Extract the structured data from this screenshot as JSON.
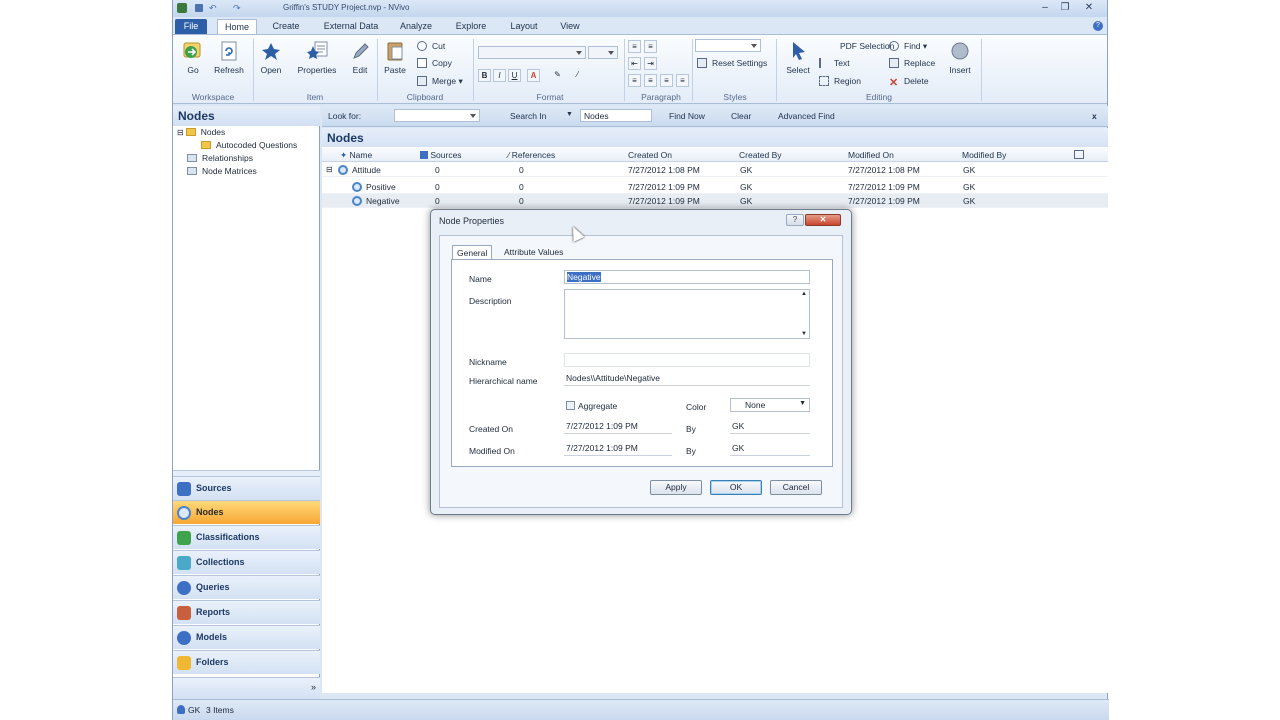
{
  "window": {
    "title": "Griffin's STUDY Project.nvp - NVivo",
    "controls": [
      "–",
      "❐",
      "✕"
    ]
  },
  "ribbon": {
    "file_tab": "File",
    "tabs": [
      "Home",
      "Create",
      "External Data",
      "Analyze",
      "Explore",
      "Layout",
      "View"
    ],
    "workspace": {
      "go": "Go",
      "refresh": "Refresh",
      "label": "Workspace"
    },
    "item": {
      "open": "Open",
      "properties": "Properties",
      "edit": "Edit",
      "label": "Item"
    },
    "clipboard": {
      "paste": "Paste",
      "cut": "Cut",
      "copy": "Copy",
      "merge": "Merge",
      "label": "Clipboard"
    },
    "format": {
      "label": "Format"
    },
    "paragraph": {
      "label": "Paragraph"
    },
    "styles": {
      "reset": "Reset Settings",
      "label": "Styles"
    },
    "editing": {
      "select": "Select",
      "pdf_selection": "PDF Selection",
      "text": "Text",
      "region": "Region",
      "find": "Find",
      "replace": "Replace",
      "delete": "Delete",
      "insert": "Insert",
      "label": "Editing"
    }
  },
  "nav": {
    "header": "Nodes",
    "tree": [
      {
        "label": "Nodes"
      },
      {
        "label": "Autocoded Questions"
      },
      {
        "label": "Relationships"
      },
      {
        "label": "Node Matrices"
      }
    ],
    "buttons": [
      {
        "label": "Sources",
        "color": "#3d6fc4"
      },
      {
        "label": "Nodes",
        "color": "#4b84c9"
      },
      {
        "label": "Classifications",
        "color": "#3fa34d"
      },
      {
        "label": "Collections",
        "color": "#4aa8c8"
      },
      {
        "label": "Queries",
        "color": "#3d6fc4"
      },
      {
        "label": "Reports",
        "color": "#c8603d"
      },
      {
        "label": "Models",
        "color": "#3d6fc4"
      },
      {
        "label": "Folders",
        "color": "#f0b832"
      }
    ]
  },
  "findbar": {
    "look_for": "Look for:",
    "look_for_value": "",
    "search_in": "Search In",
    "search_in_value": "Nodes",
    "find_now": "Find Now",
    "clear": "Clear",
    "advanced_find": "Advanced Find",
    "close": "x"
  },
  "list": {
    "title": "Nodes",
    "columns": [
      "Name",
      "Sources",
      "References",
      "Created On",
      "Created By",
      "Modified On",
      "Modified By"
    ],
    "rows": [
      {
        "name": "Attitude",
        "sources": "0",
        "references": "0",
        "created_on": "7/27/2012 1:08 PM",
        "created_by": "GK",
        "modified_on": "7/27/2012 1:08 PM",
        "modified_by": "GK"
      },
      {
        "name": "Positive",
        "sources": "0",
        "references": "0",
        "created_on": "7/27/2012 1:09 PM",
        "created_by": "GK",
        "modified_on": "7/27/2012 1:09 PM",
        "modified_by": "GK"
      },
      {
        "name": "Negative",
        "sources": "0",
        "references": "0",
        "created_on": "7/27/2012 1:09 PM",
        "created_by": "GK",
        "modified_on": "7/27/2012 1:09 PM",
        "modified_by": "GK"
      }
    ]
  },
  "status": {
    "user": "GK",
    "items": "3 Items"
  },
  "dialog": {
    "title": "Node Properties",
    "tabs": [
      "General",
      "Attribute Values"
    ],
    "name_label": "Name",
    "name_value": "Negative",
    "description_label": "Description",
    "description_value": "",
    "nickname_label": "Nickname",
    "nickname_value": "",
    "hier_label": "Hierarchical name",
    "hier_value": "Nodes\\\\Attitude\\Negative",
    "aggregate_label": "Aggregate",
    "color_label": "Color",
    "color_value": "None",
    "created_label": "Created On",
    "created_value": "7/27/2012 1:09 PM",
    "modified_label": "Modified On",
    "modified_value": "7/27/2012 1:09 PM",
    "by_label": "By",
    "created_by": "GK",
    "modified_by": "GK",
    "apply": "Apply",
    "ok": "OK",
    "cancel": "Cancel"
  }
}
